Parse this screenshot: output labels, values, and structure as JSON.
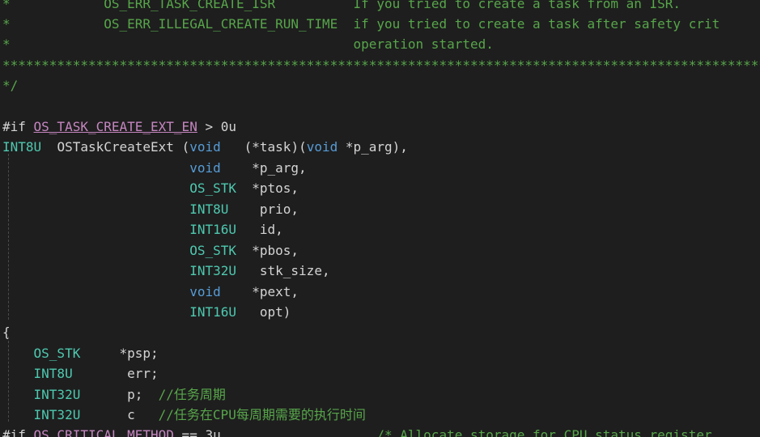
{
  "editor": {
    "lines": [
      {
        "id": "l0",
        "parts": [
          {
            "t": "*",
            "c": "c-green"
          },
          {
            "t": "            OS_ERR_TASK_CREATE_ISR          If you tried to create a task from an ISR.",
            "c": "c-green"
          }
        ]
      },
      {
        "id": "l1",
        "parts": [
          {
            "t": "*            OS_ERR_ILLEGAL_CREATE_RUN_TIME  if you tried to create a task after safety crit",
            "c": "c-green"
          }
        ]
      },
      {
        "id": "l2",
        "parts": [
          {
            "t": "*                                            operation started.",
            "c": "c-green"
          }
        ]
      },
      {
        "id": "l3",
        "parts": [
          {
            "t": "*********************************************************************************************************",
            "c": "c-green"
          }
        ]
      },
      {
        "id": "l4",
        "parts": [
          {
            "t": "*/",
            "c": "c-green"
          }
        ]
      },
      {
        "id": "l5",
        "parts": [
          {
            "t": "",
            "c": "c-text"
          }
        ]
      },
      {
        "id": "l6",
        "parts": [
          {
            "t": "#if ",
            "c": "c-text"
          },
          {
            "t": "OS_TASK_CREATE_EXT_EN",
            "c": "c-magenta u"
          },
          {
            "t": " > 0u",
            "c": "c-text"
          }
        ]
      },
      {
        "id": "l7",
        "parts": [
          {
            "t": "INT8U",
            "c": "c-teal"
          },
          {
            "t": "  OSTaskCreateExt (",
            "c": "c-text"
          },
          {
            "t": "void",
            "c": "c-kw"
          },
          {
            "t": "   (*",
            "c": "c-text"
          },
          {
            "t": "task",
            "c": "c-text"
          },
          {
            "t": ")(",
            "c": "c-text"
          },
          {
            "t": "void",
            "c": "c-kw"
          },
          {
            "t": " *p_arg),",
            "c": "c-text"
          }
        ]
      },
      {
        "id": "l8",
        "parts": [
          {
            "t": "                        ",
            "c": "c-text"
          },
          {
            "t": "void",
            "c": "c-kw"
          },
          {
            "t": "    *",
            "c": "c-text"
          },
          {
            "t": "p_arg,",
            "c": "c-text"
          }
        ]
      },
      {
        "id": "l9",
        "parts": [
          {
            "t": "                        ",
            "c": "c-text"
          },
          {
            "t": "OS_STK",
            "c": "c-teal"
          },
          {
            "t": "  *",
            "c": "c-text"
          },
          {
            "t": "ptos,",
            "c": "c-text"
          }
        ]
      },
      {
        "id": "l10",
        "parts": [
          {
            "t": "                        ",
            "c": "c-text"
          },
          {
            "t": "INT8U",
            "c": "c-teal"
          },
          {
            "t": "    prio,",
            "c": "c-text"
          }
        ]
      },
      {
        "id": "l11",
        "parts": [
          {
            "t": "                        ",
            "c": "c-text"
          },
          {
            "t": "INT16U",
            "c": "c-teal"
          },
          {
            "t": "   id,",
            "c": "c-text"
          }
        ]
      },
      {
        "id": "l12",
        "parts": [
          {
            "t": "                        ",
            "c": "c-text"
          },
          {
            "t": "OS_STK",
            "c": "c-teal"
          },
          {
            "t": "  *",
            "c": "c-text"
          },
          {
            "t": "pbos,",
            "c": "c-text"
          }
        ]
      },
      {
        "id": "l13",
        "parts": [
          {
            "t": "                        ",
            "c": "c-text"
          },
          {
            "t": "INT32U",
            "c": "c-teal"
          },
          {
            "t": "   stk_size,",
            "c": "c-text"
          }
        ]
      },
      {
        "id": "l14",
        "parts": [
          {
            "t": "                        ",
            "c": "c-text"
          },
          {
            "t": "void",
            "c": "c-kw"
          },
          {
            "t": "    *",
            "c": "c-text"
          },
          {
            "t": "pext,",
            "c": "c-text"
          }
        ]
      },
      {
        "id": "l15",
        "parts": [
          {
            "t": "                        ",
            "c": "c-text"
          },
          {
            "t": "INT16U",
            "c": "c-teal"
          },
          {
            "t": "   opt)",
            "c": "c-text"
          }
        ]
      },
      {
        "id": "l16",
        "parts": [
          {
            "t": "{",
            "c": "c-text"
          }
        ]
      },
      {
        "id": "l17",
        "parts": [
          {
            "t": "    ",
            "c": "c-text"
          },
          {
            "t": "OS_STK",
            "c": "c-teal"
          },
          {
            "t": "     *psp;",
            "c": "c-text"
          }
        ]
      },
      {
        "id": "l18",
        "parts": [
          {
            "t": "    ",
            "c": "c-text"
          },
          {
            "t": "INT8U",
            "c": "c-teal"
          },
          {
            "t": "       err;",
            "c": "c-text"
          }
        ]
      },
      {
        "id": "l19",
        "parts": [
          {
            "t": "    ",
            "c": "c-text"
          },
          {
            "t": "INT32U",
            "c": "c-teal"
          },
          {
            "t": "      p;  ",
            "c": "c-text"
          },
          {
            "t": "//任务周期",
            "c": "c-green"
          }
        ]
      },
      {
        "id": "l20",
        "parts": [
          {
            "t": "    ",
            "c": "c-text"
          },
          {
            "t": "INT32U",
            "c": "c-teal"
          },
          {
            "t": "      c   ",
            "c": "c-text"
          },
          {
            "t": "//任务在CPU每周期需要的执行时间",
            "c": "c-green"
          }
        ]
      },
      {
        "id": "l21",
        "parts": [
          {
            "t": "#if ",
            "c": "c-text"
          },
          {
            "t": "OS_CRITICAL_METHOD",
            "c": "c-magenta"
          },
          {
            "t": " == 3u",
            "c": "c-text"
          },
          {
            "t": "                    /* Allocate storage for CPU status register",
            "c": "c-green"
          }
        ]
      }
    ]
  }
}
